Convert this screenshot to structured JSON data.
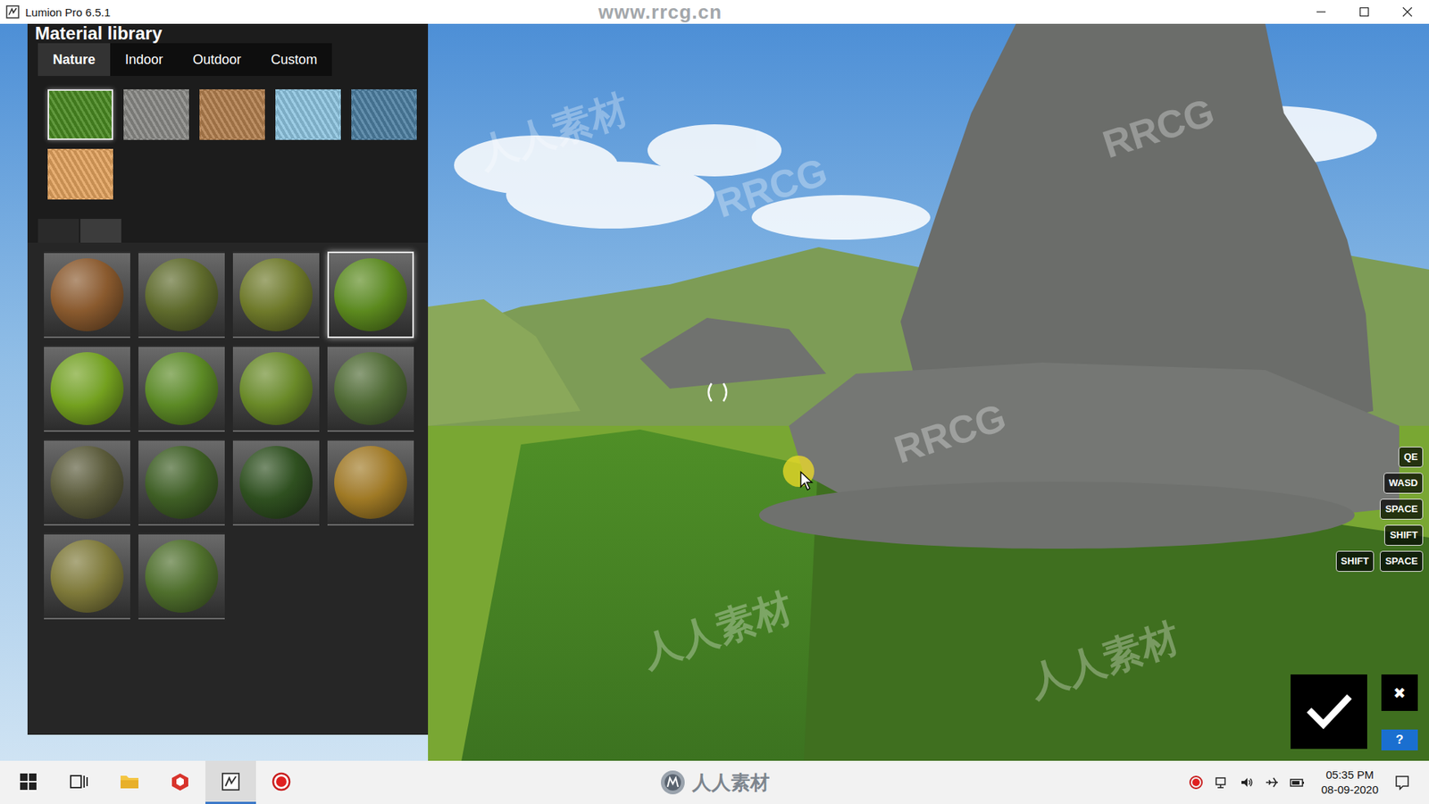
{
  "window": {
    "title": "Lumion Pro 6.5.1",
    "watermark": "www.rrcg.cn"
  },
  "library": {
    "title": "Material library",
    "tabs": [
      {
        "label": "Nature",
        "selected": true
      },
      {
        "label": "Indoor",
        "selected": false
      },
      {
        "label": "Outdoor",
        "selected": false
      },
      {
        "label": "Custom",
        "selected": false
      }
    ],
    "categories": [
      {
        "color": "#4a8a22",
        "selected": true
      },
      {
        "color": "#8a8a86",
        "selected": false
      },
      {
        "color": "#b3804f",
        "selected": false
      },
      {
        "color": "#8ec5e0",
        "selected": false
      },
      {
        "color": "#4d7fa2",
        "selected": false
      },
      {
        "color": "#e3a35f",
        "selected": false
      }
    ],
    "subtabs": [
      {
        "selected": false
      },
      {
        "selected": true
      }
    ],
    "materials": [
      {
        "color": "#8a5a2e",
        "selected": false
      },
      {
        "color": "#5f6b2c",
        "selected": false
      },
      {
        "color": "#6f7a2a",
        "selected": false
      },
      {
        "color": "#5c8a1e",
        "selected": true
      },
      {
        "color": "#74a11f",
        "selected": false
      },
      {
        "color": "#5c8a25",
        "selected": false
      },
      {
        "color": "#6a8a28",
        "selected": false
      },
      {
        "color": "#4f6a34",
        "selected": false
      },
      {
        "color": "#5a5a3a",
        "selected": false
      },
      {
        "color": "#3f5f25",
        "selected": false
      },
      {
        "color": "#2f5020",
        "selected": false
      },
      {
        "color": "#a07a25",
        "selected": false
      },
      {
        "color": "#7f7a3a",
        "selected": false
      },
      {
        "color": "#4f6f2c",
        "selected": false
      }
    ]
  },
  "keys": [
    [
      "QE"
    ],
    [
      "WASD"
    ],
    [
      "SPACE"
    ],
    [
      "SHIFT"
    ],
    [
      "SHIFT",
      "SPACE"
    ]
  ],
  "actions": {
    "cancel": "✖",
    "help": "?"
  },
  "watermarks": [
    "人人素材",
    "RRCG",
    "RRCG",
    "RRCG",
    "人人素材",
    "人人素材"
  ],
  "taskbar": {
    "apps": [
      {
        "kind": "start",
        "selected": false
      },
      {
        "kind": "taskview",
        "selected": false
      },
      {
        "kind": "explorer",
        "selected": false
      },
      {
        "kind": "sketchup",
        "selected": false
      },
      {
        "kind": "lumion",
        "selected": true
      },
      {
        "kind": "recorder",
        "selected": false
      }
    ],
    "center_logo": "人人素材",
    "tray": [
      {
        "kind": "record"
      },
      {
        "kind": "network"
      },
      {
        "kind": "volume"
      },
      {
        "kind": "airplane"
      },
      {
        "kind": "battery"
      }
    ],
    "time": "05:35 PM",
    "date": "08-09-2020"
  }
}
